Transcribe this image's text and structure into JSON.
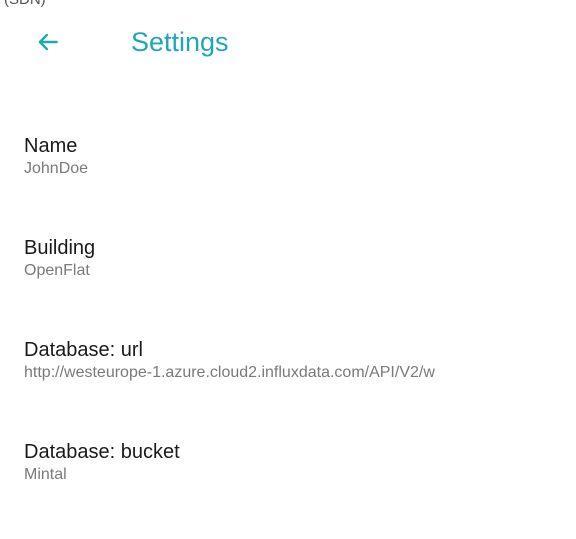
{
  "status": {
    "partial_text": "(SDN)"
  },
  "header": {
    "title": "Settings",
    "back_icon": "arrow-left-icon",
    "accent_color": "#1fa7b5"
  },
  "preferences": [
    {
      "title": "Name",
      "summary": "JohnDoe"
    },
    {
      "title": "Building",
      "summary": "OpenFlat"
    },
    {
      "title": "Database: url",
      "summary": "http://westeurope-1.azure.cloud2.influxdata.com/API/V2/w"
    },
    {
      "title": "Database: bucket",
      "summary": "Mintal"
    }
  ]
}
